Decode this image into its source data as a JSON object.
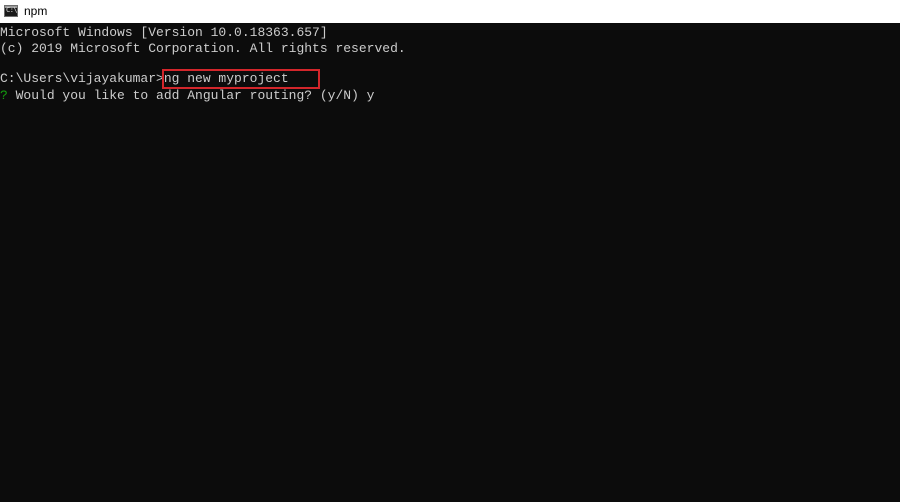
{
  "window": {
    "title": "npm",
    "icon": "cmd-console-icon",
    "icon_label": "C:\\"
  },
  "console": {
    "lines": [
      {
        "text": "Microsoft Windows [Version 10.0.18363.657]"
      },
      {
        "text": "(c) 2019 Microsoft Corporation. All rights reserved."
      },
      {
        "prompt": "C:\\Users\\vijayakumar>",
        "command": "ng new myproject"
      },
      {
        "marker": "?",
        "text": " Would you like to add Angular routing? (y/N) y"
      }
    ],
    "colors": {
      "background": "#0c0c0c",
      "foreground": "#cccccc",
      "question_marker": "#13a10e",
      "highlight_border": "#d3262b"
    }
  }
}
